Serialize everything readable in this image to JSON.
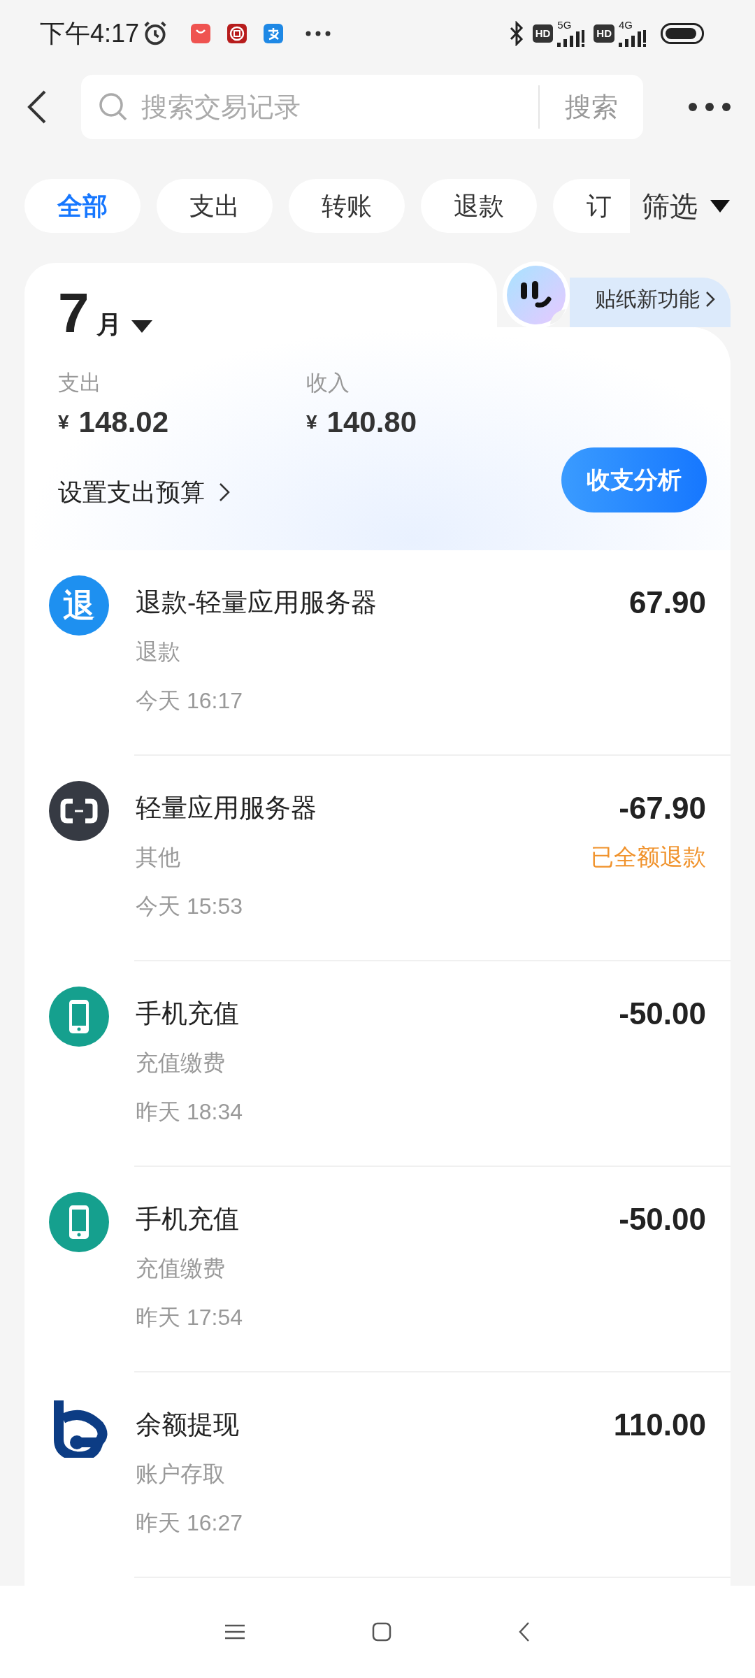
{
  "status_bar": {
    "time": "下午4:17",
    "networks": [
      {
        "badge": "HD",
        "generation": "5G"
      },
      {
        "badge": "HD",
        "generation": "4G"
      }
    ]
  },
  "search": {
    "placeholder": "搜索交易记录",
    "button": "搜索"
  },
  "filters": [
    {
      "label": "全部",
      "selected": true
    },
    {
      "label": "支出",
      "selected": false
    },
    {
      "label": "转账",
      "selected": false
    },
    {
      "label": "退款",
      "selected": false
    },
    {
      "label": "订",
      "selected": false
    }
  ],
  "filter_menu": {
    "label": "筛选"
  },
  "summary": {
    "month": "7",
    "month_unit": "月",
    "sticker": "贴纸新功能",
    "expense": {
      "label": "支出",
      "currency": "¥",
      "amount": "148.02"
    },
    "income": {
      "label": "收入",
      "currency": "¥",
      "amount": "140.80"
    },
    "budget_link": "设置支出预算",
    "analysis_button": "收支分析"
  },
  "transactions": [
    {
      "kind": "refund",
      "icon_text": "退",
      "title": "退款-轻量应用服务器",
      "category": "退款",
      "time": "今天 16:17",
      "amount": "67.90"
    },
    {
      "kind": "cloud",
      "title": "轻量应用服务器",
      "category": "其他",
      "time": "今天 15:53",
      "amount": "-67.90",
      "status": "已全额退款"
    },
    {
      "kind": "phone",
      "title": "手机充值",
      "category": "充值缴费",
      "time": "昨天 18:34",
      "amount": "-50.00"
    },
    {
      "kind": "phone",
      "title": "手机充值",
      "category": "充值缴费",
      "time": "昨天 17:54",
      "amount": "-50.00"
    },
    {
      "kind": "bank",
      "title": "余额提现",
      "category": "账户存取",
      "time": "昨天 16:27",
      "amount": "110.00"
    }
  ]
}
